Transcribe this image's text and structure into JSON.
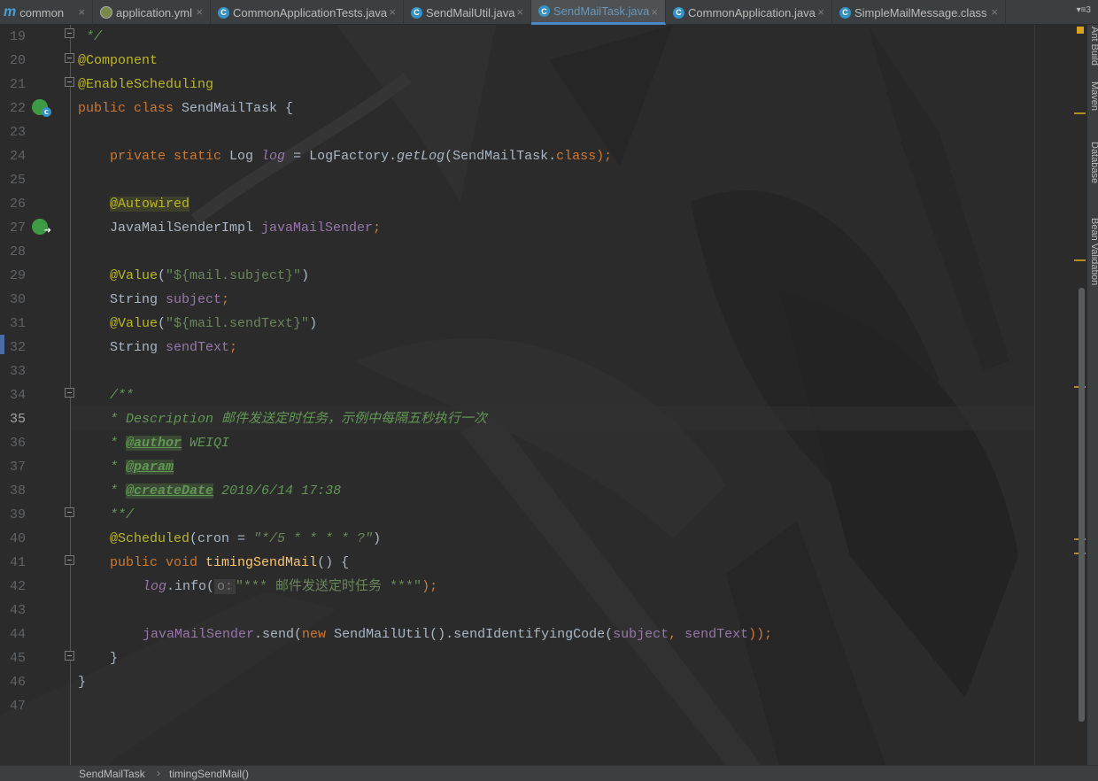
{
  "tabs": [
    {
      "label": "common",
      "icon": "maven-module-icon"
    },
    {
      "label": "application.yml",
      "icon": "yaml-file-icon"
    },
    {
      "label": "CommonApplicationTests.java",
      "icon": "java-class-icon"
    },
    {
      "label": "SendMailUtil.java",
      "icon": "java-class-icon"
    },
    {
      "label": "SendMailTask.java",
      "icon": "java-class-icon",
      "active": true
    },
    {
      "label": "CommonApplication.java",
      "icon": "java-class-icon"
    },
    {
      "label": "SimpleMailMessage.class",
      "icon": "java-class-icon"
    }
  ],
  "tab_overflow": "▾≡3",
  "side_tools": [
    "Ant Build",
    "Maven",
    "Database",
    "Bean Validation"
  ],
  "line_numbers": [
    19,
    20,
    21,
    22,
    23,
    24,
    25,
    26,
    27,
    28,
    29,
    30,
    31,
    32,
    33,
    34,
    35,
    36,
    37,
    38,
    39,
    40,
    41,
    42,
    43,
    44,
    45,
    46,
    47
  ],
  "current_line": 35,
  "code": {
    "l19": " */",
    "l20": "@Component",
    "l21": "@EnableScheduling",
    "l22": {
      "kw": "public class ",
      "name": "SendMailTask {"
    },
    "l24": {
      "kw1": "private static ",
      "type": "Log ",
      "field": "log",
      "mid": " = LogFactory.",
      "method": "getLog",
      "args": "(SendMailTask.",
      "kw2": "class",
      ")": ");"
    },
    "l26": "@Autowired",
    "l27": {
      "type": "JavaMailSenderImpl ",
      "field": "javaMailSender",
      ";": ";"
    },
    "l29": {
      "an": "@Value",
      "p1": "(",
      "str": "\"${mail.subject}\"",
      "p2": ")"
    },
    "l30": {
      "type": "String ",
      "field": "subject",
      ";": ";"
    },
    "l31": {
      "an": "@Value",
      "p1": "(",
      "str": "\"${mail.sendText}\"",
      "p2": ")"
    },
    "l32": {
      "type": "String ",
      "field": "sendText",
      ";": ";"
    },
    "l34": "/**",
    "l35": "* Description 邮件发送定时任务，示例中每隔五秒执行一次",
    "l36": {
      "pre": "* ",
      "tag": "@author",
      "post": " WEIQI"
    },
    "l37": {
      "pre": "* ",
      "tag": "@param",
      "post": ""
    },
    "l38": {
      "pre": "* ",
      "tag": "@createDate",
      "post": " 2019/6/14 17:38"
    },
    "l39": "**/",
    "l40": {
      "an": "@Scheduled",
      "p1": "(cron = ",
      "str": "\"*/5 * * * * ?\"",
      "p2": ")"
    },
    "l41": {
      "kw": "public void ",
      "method": "timingSendMail",
      "rest": "() {"
    },
    "l42": {
      "field": "log",
      "mid": ".info(",
      "hint": "o:",
      "str": "\"*** 邮件发送定时任务 ***\"",
      "end": ");"
    },
    "l44": {
      "field": "javaMailSender",
      "mid": ".send(",
      "kw": "new ",
      "cls": "SendMailUtil().sendIdentifyingCode(",
      "a1": "subject",
      ", ": ", ",
      "a2": "sendText",
      "end": "));"
    },
    "l45": "}",
    "l46": "}"
  },
  "breadcrumb": [
    "SendMailTask",
    "timingSendMail()"
  ],
  "colors": {
    "keyword": "#cc7832",
    "annotation": "#bbb529",
    "field": "#9876aa",
    "string": "#6a8759",
    "doc": "#629755",
    "text": "#a9b7c6",
    "active_tab_text": "#6897bb"
  }
}
